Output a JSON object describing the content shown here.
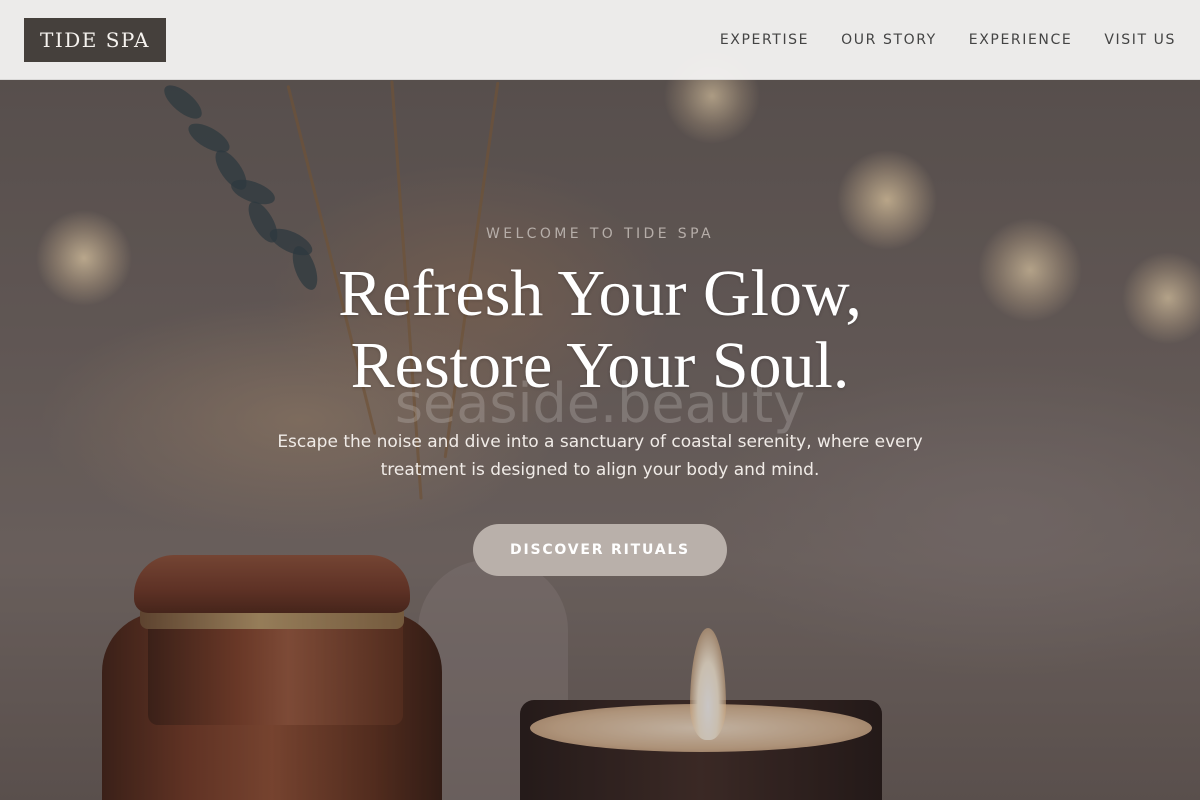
{
  "header": {
    "logo": "TIDE SPA",
    "nav": [
      {
        "label": "EXPERTISE"
      },
      {
        "label": "OUR STORY"
      },
      {
        "label": "EXPERIENCE"
      },
      {
        "label": "VISIT US"
      }
    ]
  },
  "hero": {
    "eyebrow": "WELCOME TO TIDE SPA",
    "headline_line1": "Refresh Your Glow,",
    "headline_line2": "Restore Your Soul.",
    "watermark": "seaside.beauty",
    "subtext": "Escape the noise and dive into a sanctuary of coastal serenity, where every treatment is designed to align your body and mind.",
    "cta_label": "DISCOVER RITUALS"
  },
  "colors": {
    "logo_bg": "#45403c",
    "header_bg": "#f2f1f0",
    "cta_bg": "#b9b0aa",
    "headline": "#ffffff"
  }
}
